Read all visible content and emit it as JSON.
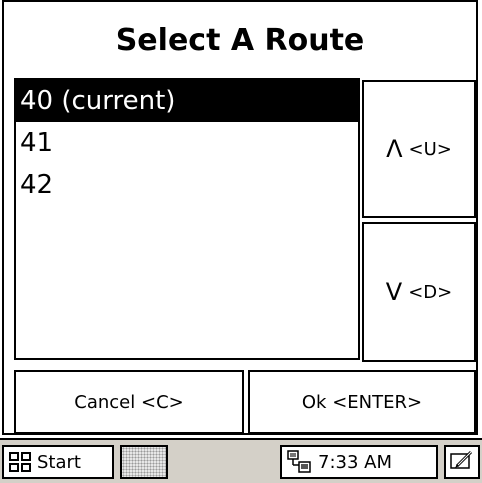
{
  "dialog": {
    "title": "Select A Route"
  },
  "routes": {
    "items": [
      {
        "label": "40 (current)",
        "selected": true
      },
      {
        "label": "41",
        "selected": false
      },
      {
        "label": "42",
        "selected": false
      }
    ]
  },
  "buttons": {
    "up_arrow": "Λ",
    "up_label": "<U>",
    "down_arrow": "V",
    "down_label": "<D>",
    "cancel": "Cancel <C>",
    "ok": "Ok <ENTER>"
  },
  "taskbar": {
    "start_label": "Start",
    "start_icon": "windows-flag-icon",
    "network_icon": "network-icon",
    "clock": "7:33 AM",
    "sip_icon": "pencil-input-icon"
  },
  "colors": {
    "background": "#ffffff",
    "text": "#000000",
    "selected_bg": "#000000",
    "selected_text": "#ffffff",
    "taskbar_bg": "#d4d0c8"
  }
}
